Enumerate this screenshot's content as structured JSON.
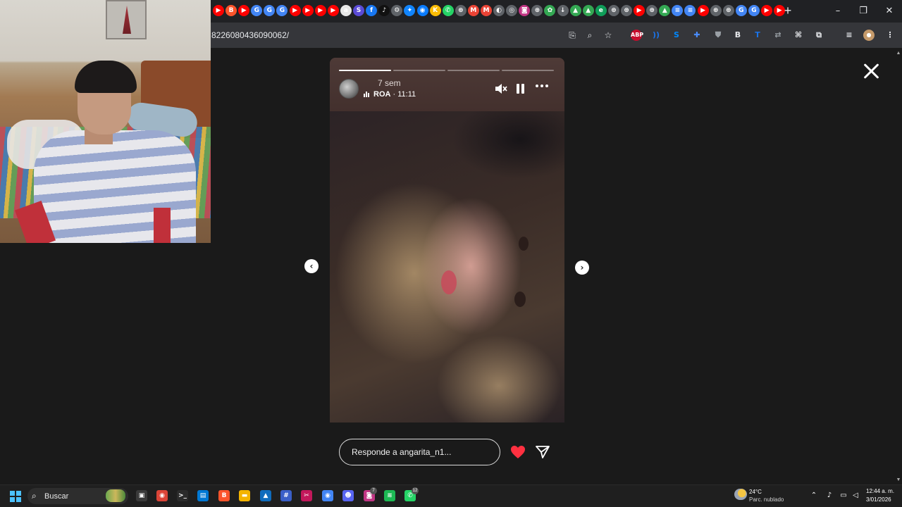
{
  "browser": {
    "address_url": "8226080436090062/",
    "new_tab_label": "+",
    "tab_icons": [
      {
        "name": "youtube-tab-icon",
        "color": "#ff0000",
        "glyph": "▶"
      },
      {
        "name": "brave-tab-icon",
        "color": "#fb542b",
        "glyph": "B"
      },
      {
        "name": "youtube-tab-icon",
        "color": "#ff0000",
        "glyph": "▶"
      },
      {
        "name": "google-tab-icon",
        "color": "#4285f4",
        "glyph": "G"
      },
      {
        "name": "google-tab-icon",
        "color": "#4285f4",
        "glyph": "G"
      },
      {
        "name": "google-tab-icon",
        "color": "#4285f4",
        "glyph": "G"
      },
      {
        "name": "youtube-tab-icon",
        "color": "#ff0000",
        "glyph": "▶"
      },
      {
        "name": "youtube-tab-icon",
        "color": "#ff0000",
        "glyph": "▶"
      },
      {
        "name": "youtube-tab-icon",
        "color": "#ff0000",
        "glyph": "▶"
      },
      {
        "name": "youtube-tab-icon",
        "color": "#ff0000",
        "glyph": "▶"
      },
      {
        "name": "amazon-tab-icon",
        "color": "#e8e8e8",
        "glyph": "a"
      },
      {
        "name": "sss-tab-icon",
        "color": "#5b4bd6",
        "glyph": "S"
      },
      {
        "name": "facebook-tab-icon",
        "color": "#1877f2",
        "glyph": "f"
      },
      {
        "name": "tiktok-tab-icon",
        "color": "#111111",
        "glyph": "♪"
      },
      {
        "name": "settings-tab-icon",
        "color": "#5f6368",
        "glyph": "⚙"
      },
      {
        "name": "bluesky-tab-icon",
        "color": "#1185fe",
        "glyph": "✦"
      },
      {
        "name": "messenger-tab-icon",
        "color": "#0a7cff",
        "glyph": "◉"
      },
      {
        "name": "keep-tab-icon",
        "color": "#fbbc04",
        "glyph": "K"
      },
      {
        "name": "whatsapp-tab-icon",
        "color": "#25d366",
        "glyph": "✆"
      },
      {
        "name": "chatgpt-tab-icon",
        "color": "#5f6368",
        "glyph": "⊛"
      },
      {
        "name": "gmail-tab-icon",
        "color": "#ea4335",
        "glyph": "M"
      },
      {
        "name": "gmail-tab-icon",
        "color": "#ea4335",
        "glyph": "M"
      },
      {
        "name": "github-tab-icon",
        "color": "#5f6368",
        "glyph": "◐"
      },
      {
        "name": "steam-tab-icon",
        "color": "#5f6368",
        "glyph": "◎"
      },
      {
        "name": "instagram-tab-icon",
        "color": "#c13584",
        "glyph": "◙"
      },
      {
        "name": "chatgpt-tab-icon",
        "color": "#5f6368",
        "glyph": "⊛"
      },
      {
        "name": "photos-tab-icon",
        "color": "#34a853",
        "glyph": "✿"
      },
      {
        "name": "download-tab-icon",
        "color": "#5f6368",
        "glyph": "↓"
      },
      {
        "name": "drive-tab-icon",
        "color": "#34a853",
        "glyph": "▲"
      },
      {
        "name": "drive-tab-icon",
        "color": "#34a853",
        "glyph": "▲"
      },
      {
        "name": "edge-tab-icon",
        "color": "#0f9d58",
        "glyph": "e"
      },
      {
        "name": "gpt-tab-icon",
        "color": "#5f6368",
        "glyph": "⊛"
      },
      {
        "name": "gpt-tab-icon",
        "color": "#5f6368",
        "glyph": "⊛"
      },
      {
        "name": "youtube-tab-icon",
        "color": "#ff0000",
        "glyph": "▶"
      },
      {
        "name": "gpt-tab-icon",
        "color": "#5f6368",
        "glyph": "⊛"
      },
      {
        "name": "drive-tab-icon",
        "color": "#34a853",
        "glyph": "▲"
      },
      {
        "name": "docs-tab-icon",
        "color": "#4285f4",
        "glyph": "≡"
      },
      {
        "name": "docs-tab-icon",
        "color": "#4285f4",
        "glyph": "≡"
      },
      {
        "name": "youtube-tab-icon",
        "color": "#ff0000",
        "glyph": "▶"
      },
      {
        "name": "chatgpt-tab-icon",
        "color": "#5f6368",
        "glyph": "⊛"
      },
      {
        "name": "chatgpt-tab-icon",
        "color": "#5f6368",
        "glyph": "⊛"
      },
      {
        "name": "google-tab-icon",
        "color": "#4285f4",
        "glyph": "G"
      },
      {
        "name": "google-tab-icon",
        "color": "#4285f4",
        "glyph": "G"
      },
      {
        "name": "youtube-tab-icon",
        "color": "#ff0000",
        "glyph": "▶"
      },
      {
        "name": "youtube-tab-icon",
        "color": "#ff0000",
        "glyph": "▶"
      }
    ],
    "extensions": [
      {
        "name": "adblock-plus-icon",
        "glyph": "ABP",
        "color": "#c70d2c"
      },
      {
        "name": "audio-extension-icon",
        "glyph": "))",
        "color": "#1a73e8"
      },
      {
        "name": "shazam-extension-icon",
        "glyph": "S",
        "color": "#0088ff"
      },
      {
        "name": "puzzle-blue-extension-icon",
        "glyph": "✚",
        "color": "#4a8cff"
      },
      {
        "name": "shield-extension-icon",
        "glyph": "⛊",
        "color": "#9aa0a6"
      },
      {
        "name": "bookmark-extension-icon",
        "glyph": "B",
        "color": "#e8eaed"
      },
      {
        "name": "translate-extension-icon",
        "glyph": "T",
        "color": "#1a73e8"
      },
      {
        "name": "link-extension-icon",
        "glyph": "⇄",
        "color": "#9aa0a6"
      },
      {
        "name": "glasses-extension-icon",
        "glyph": "⌘",
        "color": "#e8eaed"
      },
      {
        "name": "extensions-puzzle-icon",
        "glyph": "⧉",
        "color": "#e8eaed"
      },
      {
        "name": "reading-list-icon",
        "glyph": "≡",
        "color": "#e8eaed"
      },
      {
        "name": "profile-avatar-icon",
        "glyph": "●",
        "color": "#c59a6a"
      },
      {
        "name": "chrome-menu-icon",
        "glyph": "⋮",
        "color": "#e8eaed"
      }
    ]
  },
  "story": {
    "progress": [
      1.0,
      0.0,
      0.0,
      0.0
    ],
    "time_ago": "7 sem",
    "audio_label": "ROA",
    "audio_duration": " · 11:11",
    "accent_color": "#ff3040"
  },
  "reply": {
    "placeholder": "Responde a angarita_n1..."
  },
  "taskbar": {
    "search_label": "Buscar",
    "apps": [
      {
        "name": "task-view-icon",
        "glyph": "▣",
        "color": "#3a3a3a"
      },
      {
        "name": "chrome-red-app-icon",
        "glyph": "◉",
        "color": "#db4437"
      },
      {
        "name": "terminal-app-icon",
        "glyph": ">_",
        "color": "#2b2b2b"
      },
      {
        "name": "store-app-icon",
        "glyph": "▤",
        "color": "#0078d4"
      },
      {
        "name": "brave-app-icon",
        "glyph": "B",
        "color": "#fb542b"
      },
      {
        "name": "explorer-app-icon",
        "glyph": "▬",
        "color": "#f4b400"
      },
      {
        "name": "photos-app-icon",
        "glyph": "▲",
        "color": "#0f6cbd"
      },
      {
        "name": "calculator-app-icon",
        "glyph": "#",
        "color": "#3a5fc8"
      },
      {
        "name": "snipping-app-icon",
        "glyph": "✂",
        "color": "#c2185b"
      },
      {
        "name": "chrome-app-icon",
        "glyph": "◉",
        "color": "#4285f4"
      },
      {
        "name": "discord-app-icon",
        "glyph": "☻",
        "color": "#5865f2"
      },
      {
        "name": "instagram-app-icon",
        "glyph": "◙",
        "color": "#c13584"
      },
      {
        "name": "spotify-app-icon",
        "glyph": "≋",
        "color": "#1db954"
      },
      {
        "name": "whatsapp-app-icon",
        "glyph": "✆",
        "color": "#25d366"
      }
    ],
    "instagram_badge": "7",
    "whatsapp_badge": "12",
    "weather_temp": "24°C",
    "weather_desc": "Parc. nublado",
    "time": "12:44 a. m.",
    "date": "3/01/2026"
  }
}
